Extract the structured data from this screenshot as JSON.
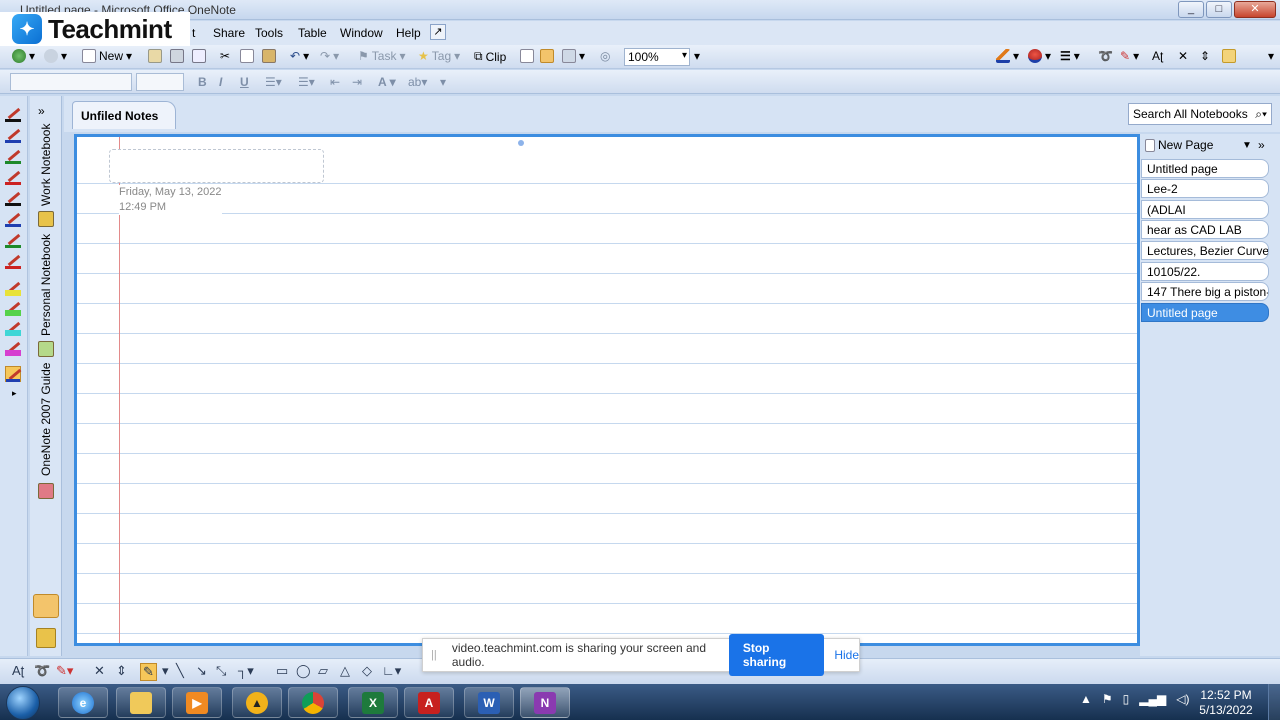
{
  "window": {
    "title": "Untitled page - Microsoft Office OneNote",
    "controls": [
      "_",
      "□",
      "✕"
    ]
  },
  "overlay_logo": {
    "text": "Teachmint"
  },
  "menu": {
    "items": [
      {
        "label": "t"
      },
      {
        "label": "Share"
      },
      {
        "label": "Tools"
      },
      {
        "label": "Table"
      },
      {
        "label": "Window"
      },
      {
        "label": "Help"
      }
    ]
  },
  "toolbar": {
    "new_label": "New",
    "task_label": "Task",
    "tag_label": "Tag",
    "clip_label": "Clip",
    "zoom_value": "100%"
  },
  "format": {
    "bold": "B",
    "italic": "I",
    "underline": "U",
    "font_color": "A"
  },
  "notebooks": [
    {
      "label": "Work Notebook",
      "color": "#e8c34a"
    },
    {
      "label": "Personal Notebook",
      "color": "#b5d98a"
    },
    {
      "label": "OneNote 2007 Guide",
      "color": "#e07a86"
    }
  ],
  "section": {
    "active_tab": "Unfiled Notes"
  },
  "search": {
    "placeholder": "Search All Notebooks"
  },
  "page": {
    "date": "Friday, May 13, 2022",
    "time": "12:49 PM"
  },
  "pages_pane": {
    "new_page_label": "New Page",
    "pages": [
      {
        "label": "Untitled page",
        "active": false
      },
      {
        "label": "Lee-2",
        "active": false
      },
      {
        "label": "(ADLAI",
        "active": false
      },
      {
        "label": "hear as CAD LAB",
        "active": false
      },
      {
        "label": "Lectures, Bezier Curve.",
        "active": false
      },
      {
        "label": "10105/22.",
        "active": false
      },
      {
        "label": "147 There big a piston-",
        "active": false
      },
      {
        "label": "Untitled page",
        "active": true
      }
    ]
  },
  "share_notice": {
    "message": "video.teachmint.com is sharing your screen and audio.",
    "stop_label": "Stop sharing",
    "hide_label": "Hide"
  },
  "taskbar": {
    "apps": [
      "ie-icon",
      "explorer-icon",
      "media-player-icon",
      "vlc-like-icon",
      "chrome-icon",
      "excel-icon",
      "acrobat-icon",
      "word-icon",
      "onenote-icon"
    ],
    "clock_time": "12:52 PM",
    "clock_date": "5/13/2022"
  }
}
